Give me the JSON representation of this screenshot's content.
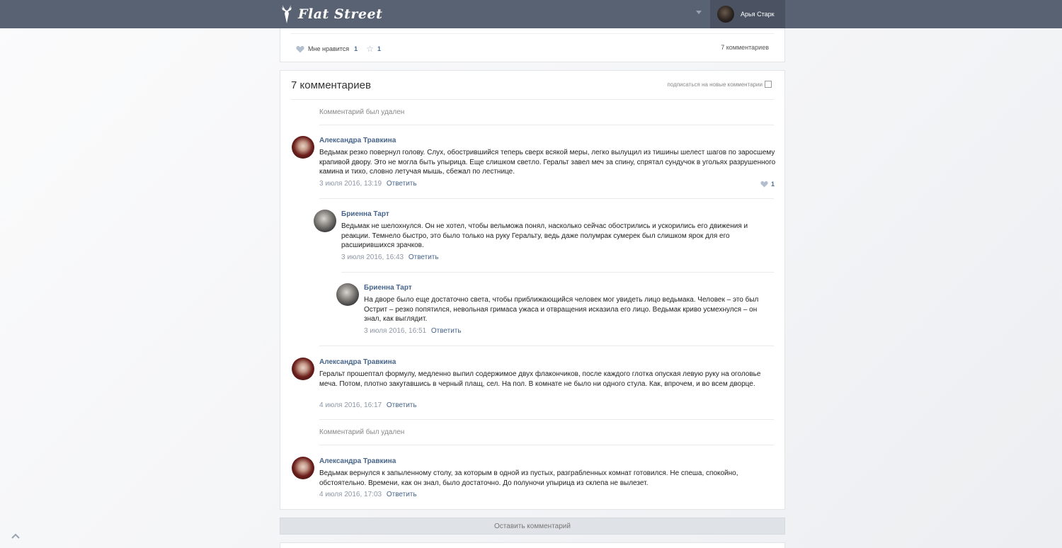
{
  "header": {
    "logo_text": "Flat Street",
    "user_name": "Арья Старк"
  },
  "post_footer": {
    "like_label": "Мне нравится",
    "like_count": "1",
    "star_count": "1",
    "comments_link": "7 комментариев"
  },
  "comments_section": {
    "title": "7 комментариев",
    "subscribe_label": "подписаться на новые комментарии",
    "reply_label": "Ответить",
    "deleted_text": "Комментарий был удален",
    "items": [
      {
        "author": "Александра Травкина",
        "text": "Ведьмак резко повернул голову. Слух, обострившийся теперь сверх всякой меры, легко вылущил из тишины шелест шагов по заросшему крапивой двору. Это не могла быть упырица. Еще слишком светло. Геральт завел меч за спину, спрятал сундучок в угольях разрушенного камина и тихо, словно летучая мышь, сбежал по лестнице.",
        "date": "3 июля 2016, 13:19",
        "likes": "1"
      },
      {
        "author": "Бриенна Тарт",
        "text": "Ведьмак не шелохнулся. Он не хотел, чтобы вельможа понял, насколько сейчас обострились и ускорились его движения и реакции. Темнело быстро, это было только на руку Геральту, ведь даже полумрак сумерек был слишком ярок для его расширившихся зрачков.",
        "date": "3 июля 2016, 16:43"
      },
      {
        "author": "Бриенна Тарт",
        "text": "На дворе было еще достаточно света, чтобы приближающийся человек мог увидеть лицо ведьмака. Человек – это был Острит – резко попятился, невольная гримаса ужаса и отвращения исказила его лицо. Ведьмак криво усмехнулся – он знал, как выглядит.",
        "date": "3 июля 2016, 16:51"
      },
      {
        "author": "Александра Травкина",
        "text": "Геральт прошептал формулу, медленно выпил содержимое двух флакончиков, после каждого глотка опуская левую руку на оголовье меча. Потом, плотно закутавшись в черный плащ, сел. На пол. В комнате не было ни одного стула. Как, впрочем, и во всем дворце.",
        "date": "4 июля 2016, 16:17"
      },
      {
        "author": "Александра Травкина",
        "text": "Ведьмак вернулся к запыленному столу, за которым в одной из пустых, разграбленных комнат готовился. Не спеша, спокойно, обстоятельно. Времени, как он знал, было достаточно. До полуночи упырица из склепа не вылезет.",
        "date": "4 июля 2016, 17:03"
      }
    ]
  },
  "leave_comment_label": "Оставить комментарий",
  "colors": {
    "topbar": "#596273",
    "accent_link": "#47648a",
    "muted": "#8e98a7"
  }
}
